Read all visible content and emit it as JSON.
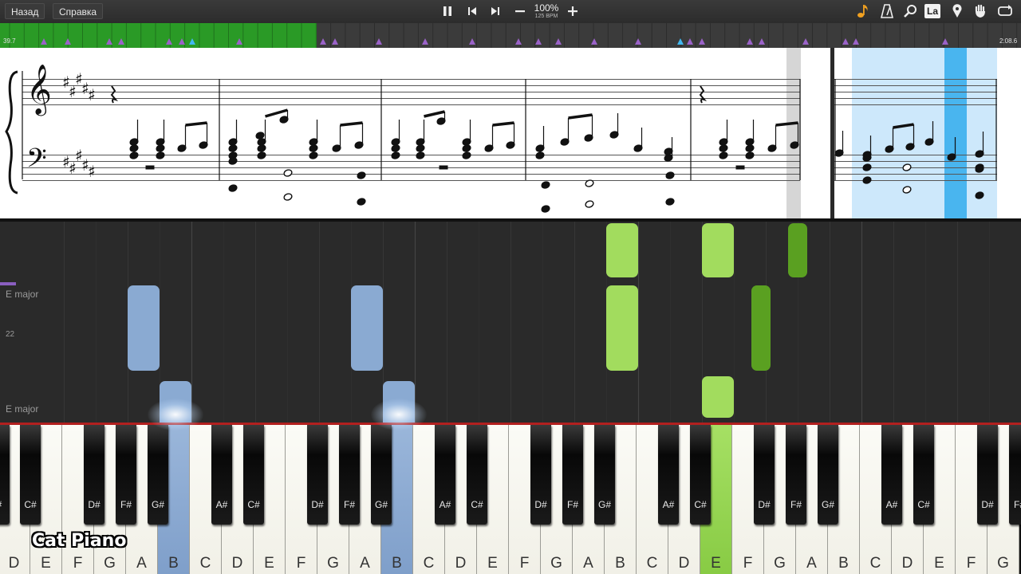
{
  "toolbar": {
    "back_label": "Назад",
    "help_label": "Справка",
    "zoom_label": "100%",
    "tempo_label": "125 BPM",
    "icons": [
      "pause-icon",
      "skip-back-icon",
      "skip-forward-icon",
      "minus-icon",
      "plus-icon",
      "note-icon",
      "metronome-icon",
      "magnifier-icon",
      "la-icon",
      "location-icon",
      "hand-icon",
      "loop-icon"
    ],
    "la_label": "La"
  },
  "progress": {
    "fraction": 0.31,
    "time_left": "39.7",
    "time_right": "2:08.6",
    "fill_color": "#2a9a26"
  },
  "roll": {
    "key_label_top": "E major",
    "key_label_bottom": "E major",
    "measure_number": "22",
    "colors": {
      "left_hand": "#8aaad2",
      "right_hand_light": "#a2dc5e",
      "right_hand_dark": "#5aa021"
    }
  },
  "keyboard": {
    "white_labels": [
      "D",
      "E",
      "F",
      "G",
      "A",
      "B",
      "C",
      "D",
      "E",
      "F",
      "G",
      "A",
      "B",
      "C",
      "D",
      "E",
      "F",
      "G",
      "A",
      "B",
      "C",
      "D",
      "E",
      "F",
      "G",
      "A",
      "B",
      "C",
      "D",
      "E",
      "F",
      "G"
    ],
    "black_labels": [
      "C#",
      "D#",
      "F#",
      "G#",
      "A#",
      "C#",
      "D#",
      "F#",
      "G#",
      "A#",
      "C#",
      "D#",
      "F#",
      "G#",
      "A#",
      "C#",
      "D#",
      "F#",
      "G#",
      "A#",
      "C#",
      "D#",
      "F#",
      "G#",
      "A#",
      "C#",
      "D#",
      "F#",
      "G#"
    ],
    "pressed_left": [
      "B",
      "B"
    ],
    "pressed_right": [
      "E"
    ]
  },
  "branding": {
    "text": "Cat Piano"
  }
}
